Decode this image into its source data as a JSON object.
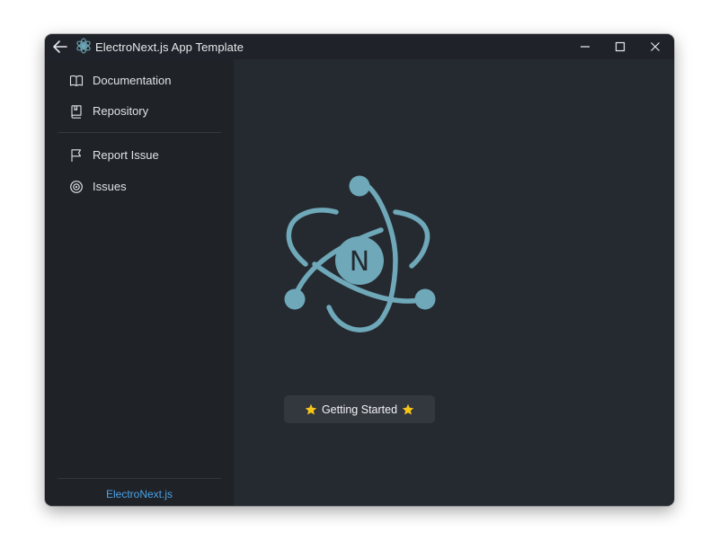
{
  "window": {
    "title": "ElectroNext.js App Template"
  },
  "sidebar": {
    "items": [
      {
        "label": "Documentation",
        "icon": "book-open-icon"
      },
      {
        "label": "Repository",
        "icon": "repo-icon"
      },
      {
        "label": "Report Issue",
        "icon": "flag-icon"
      },
      {
        "label": "Issues",
        "icon": "target-icon"
      }
    ],
    "footer_link": "ElectroNext.js"
  },
  "main": {
    "logo_letter": "N",
    "button_label": "Getting Started"
  },
  "colors": {
    "window_bg": "#1f2329",
    "main_bg": "#252a31",
    "accent_logo": "#6fa8b8",
    "link": "#4aa3e8",
    "star": "#f5c518"
  }
}
